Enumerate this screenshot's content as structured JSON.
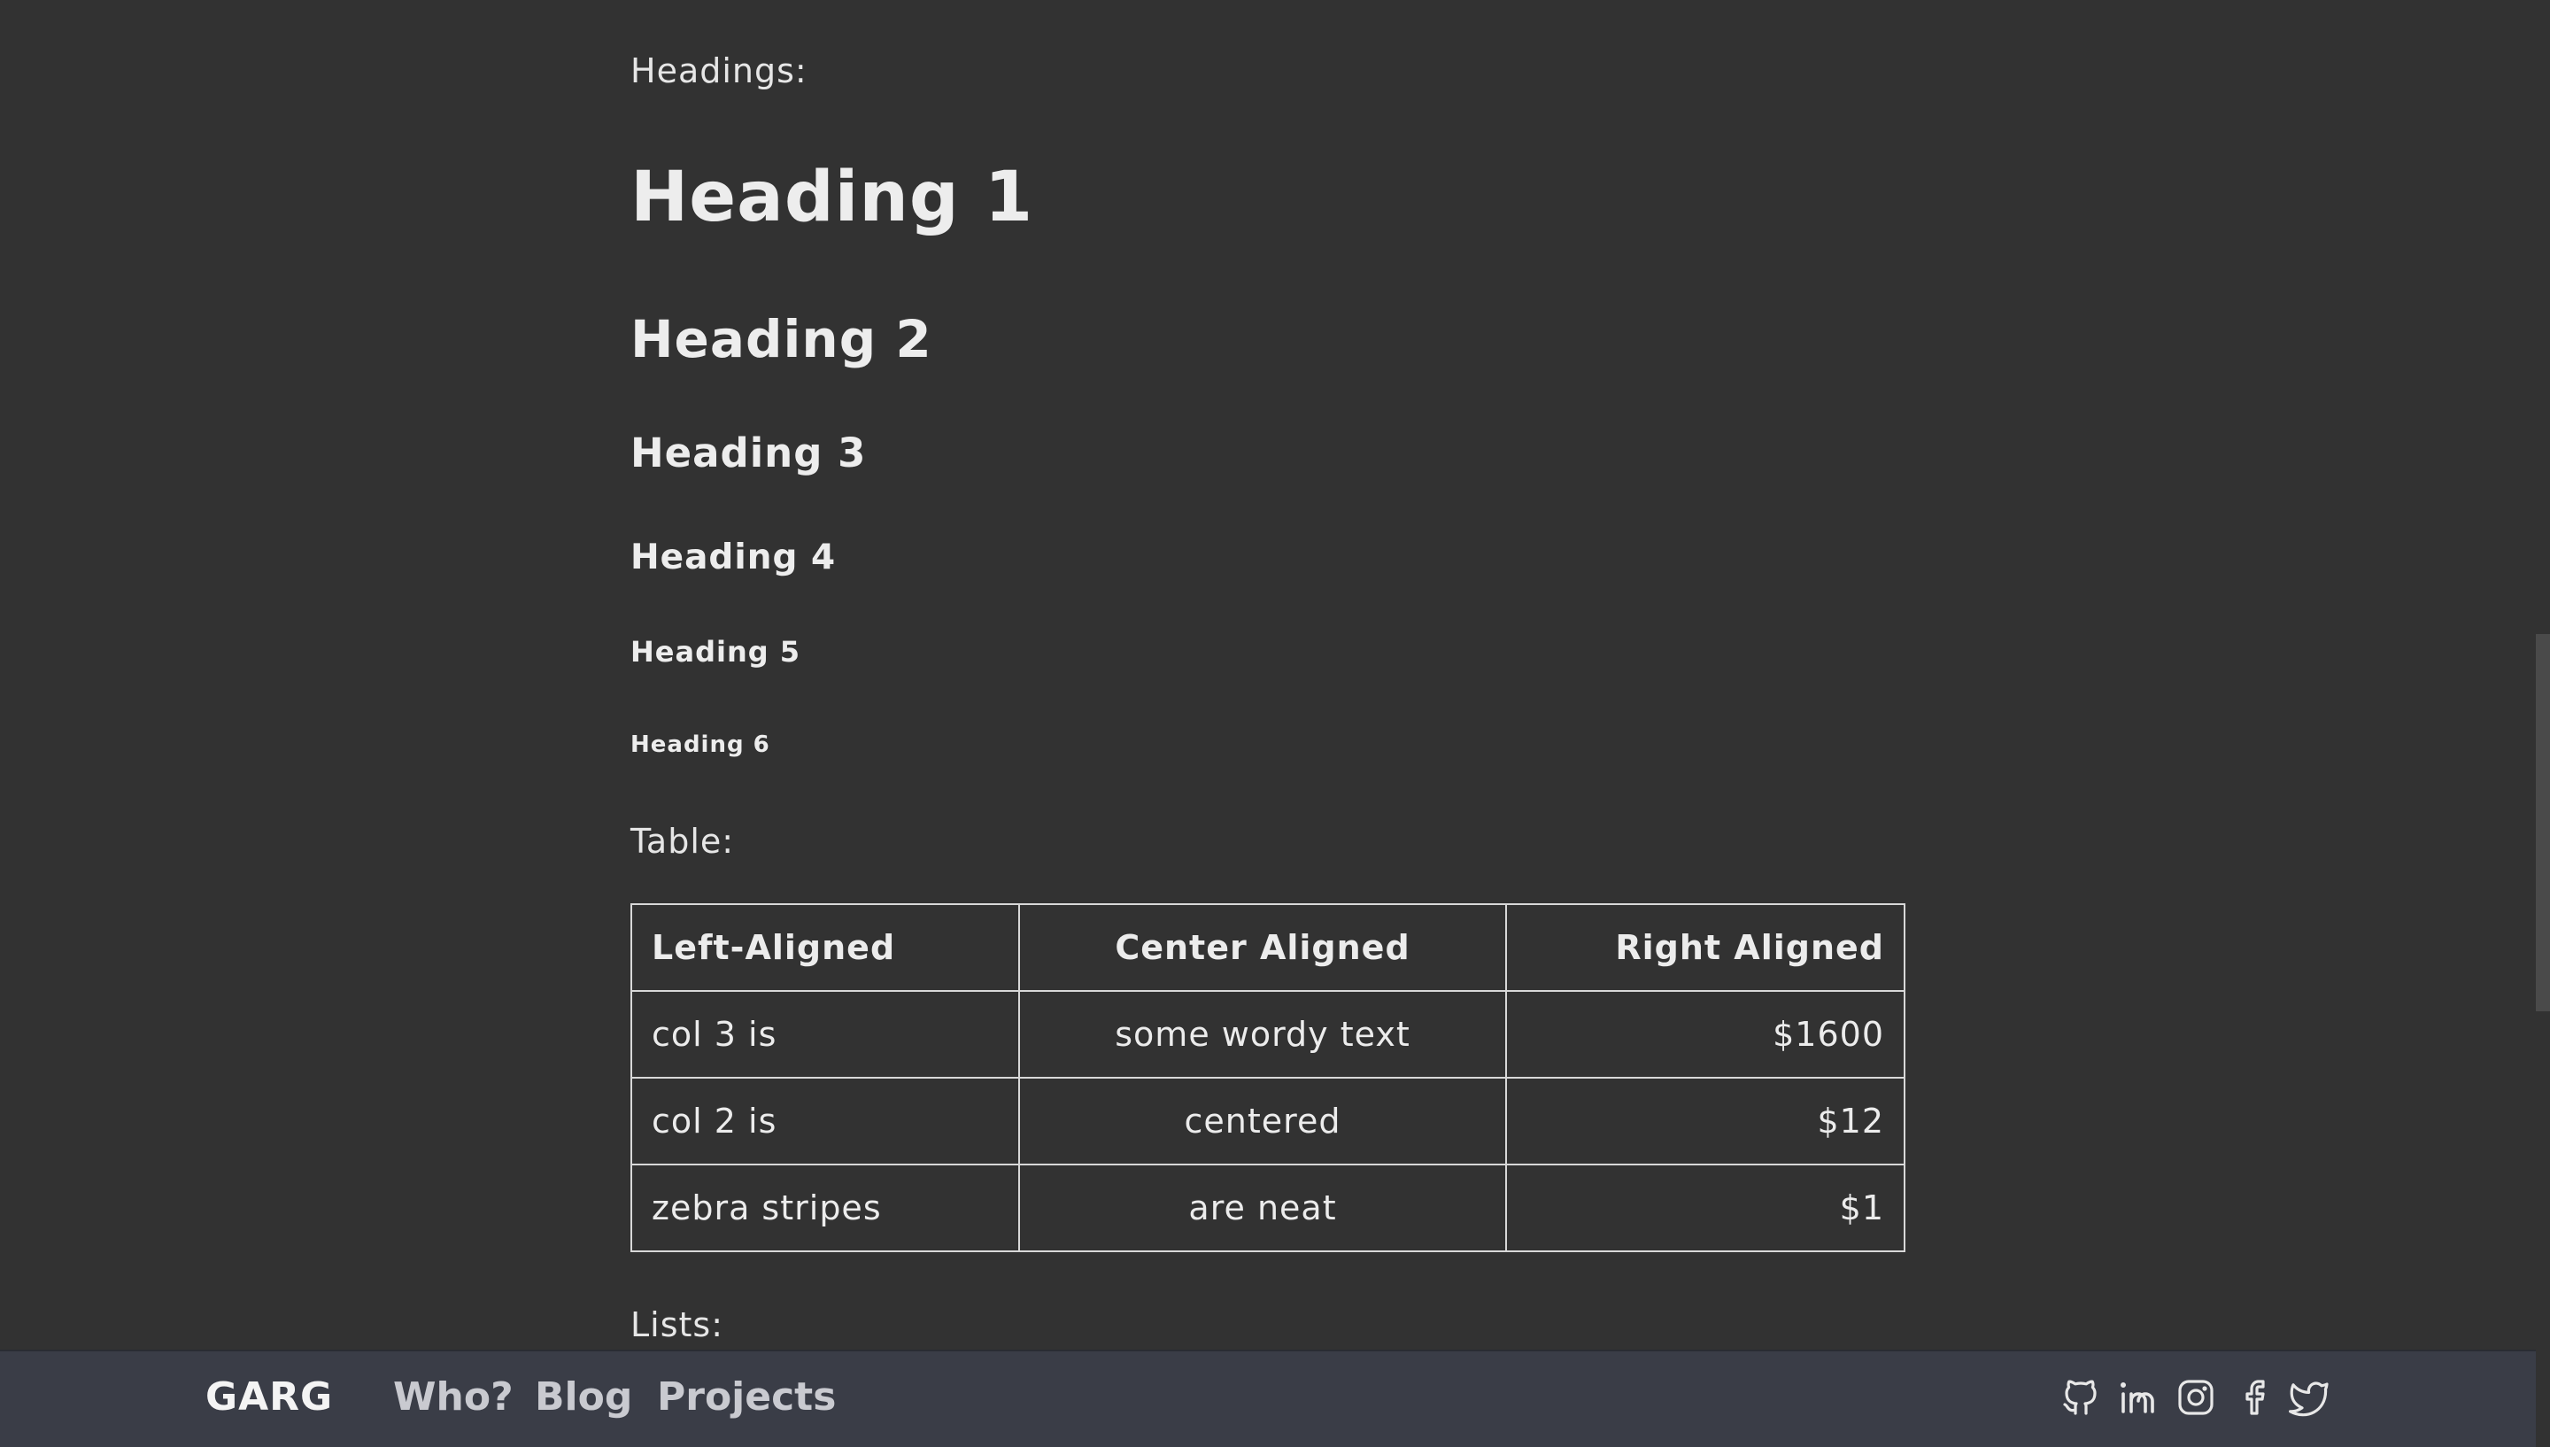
{
  "content": {
    "headings_label": "Headings:",
    "headings": {
      "h1": "Heading 1",
      "h2": "Heading 2",
      "h3": "Heading 3",
      "h4": "Heading 4",
      "h5": "Heading 5",
      "h6": "Heading 6"
    },
    "table_label": "Table:",
    "table": {
      "headers": [
        "Left-Aligned",
        "Center Aligned",
        "Right Aligned"
      ],
      "rows": [
        [
          "col 3 is",
          "some wordy text",
          "$1600"
        ],
        [
          "col 2 is",
          "centered",
          "$12"
        ],
        [
          "zebra stripes",
          "are neat",
          "$1"
        ]
      ]
    },
    "lists_label": "Lists:"
  },
  "footer": {
    "brand": "GARG",
    "nav": [
      "Who?",
      "Blog",
      "Projects"
    ],
    "social_icons": [
      "github-icon",
      "linkedin-icon",
      "instagram-icon",
      "facebook-icon",
      "twitter-icon"
    ]
  },
  "colors": {
    "background": "#323232",
    "footer_bg": "#3a3d47",
    "text": "#ececec",
    "nav_text": "#c9cad0"
  }
}
